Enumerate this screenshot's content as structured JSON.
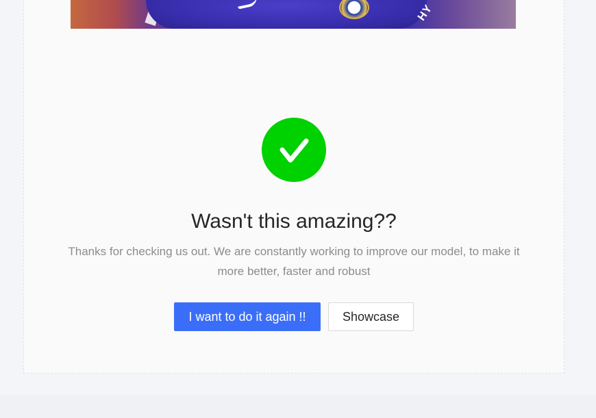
{
  "result": {
    "image_alt": "Processed photo of a player in a blue Chelsea jersey",
    "sponsor_text": "HY"
  },
  "success": {
    "icon": "check-icon",
    "icon_color": "#00d100",
    "title": "Wasn't this amazing??",
    "description": "Thanks for checking us out. We are constantly working to improve our model, to make it more better, faster and robust"
  },
  "actions": {
    "primary_label": "I want to do it again !!",
    "secondary_label": "Showcase",
    "primary_color": "#3b6ef8"
  }
}
